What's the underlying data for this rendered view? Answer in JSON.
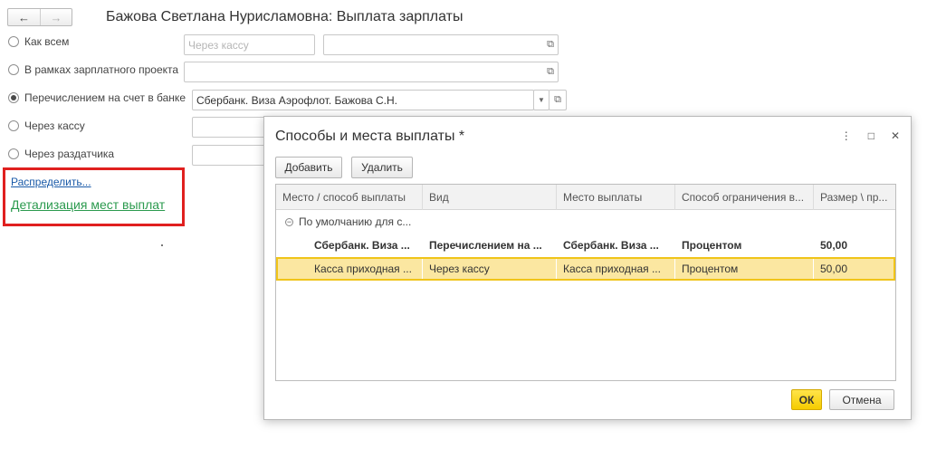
{
  "header": {
    "title": "Бажова Светлана Нурисламовна: Выплата зарплаты",
    "back_icon": "←",
    "forward_icon": "→"
  },
  "options": [
    {
      "label": "Как всем",
      "checked": false
    },
    {
      "label": "В рамках зарплатного проекта",
      "checked": false
    },
    {
      "label": "Перечислением на счет в банке",
      "checked": true
    },
    {
      "label": "Через кассу",
      "checked": false
    },
    {
      "label": "Через раздатчика",
      "checked": false
    }
  ],
  "fields": {
    "kak_vsem_placeholder": "Через кассу",
    "bank_account_value": "Сбербанк. Виза Аэрофлот. Бажова С.Н."
  },
  "links": {
    "raspredelit": "Распределить...",
    "detalizaciya": "Детализация мест выплат"
  },
  "dialog": {
    "title": "Способы и места выплаты *",
    "add_button": "Добавить",
    "delete_button": "Удалить",
    "ok_button": "ОК",
    "cancel_button": "Отмена",
    "more_icon": "⋮",
    "maximize_icon": "□",
    "close_icon": "✕",
    "columns": [
      "Место / способ выплаты",
      "Вид",
      "Место выплаты",
      "Способ ограничения в...",
      "Размер \\ пр..."
    ],
    "group_row": "По умолчанию для с...",
    "rows": [
      {
        "place": "Сбербанк. Виза ...",
        "kind": "Перечислением на ...",
        "location": "Сбербанк. Виза ...",
        "limit": "Процентом",
        "size": "50,00",
        "bold": true,
        "selected": false
      },
      {
        "place": "Касса приходная ...",
        "kind": "Через кассу",
        "location": "Касса приходная ...",
        "limit": "Процентом",
        "size": "50,00",
        "bold": false,
        "selected": true
      }
    ]
  },
  "colors": {
    "highlight_box": "#e0201f",
    "selected_row": "#fbe7a1",
    "ok_button": "#f5cc00",
    "link_blue": "#1a5aa8",
    "link_green": "#2b9a4e"
  }
}
